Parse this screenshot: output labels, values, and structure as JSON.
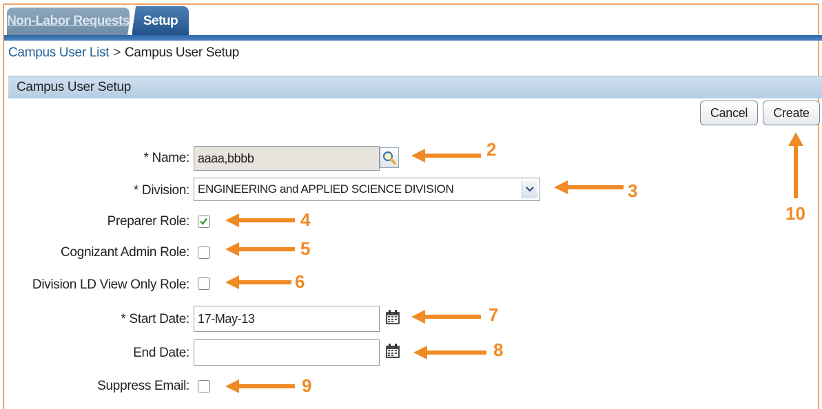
{
  "tabs": [
    {
      "label": "Non-Labor Requests"
    },
    {
      "label": "Setup"
    }
  ],
  "breadcrumb": {
    "link": "Campus User List",
    "separator": ">",
    "current": "Campus User Setup"
  },
  "section": {
    "title": "Campus User Setup"
  },
  "buttons": {
    "cancel": "Cancel",
    "create": "Create"
  },
  "form": {
    "name": {
      "label": "* Name:",
      "value": "aaaa,bbbb"
    },
    "division": {
      "label": "* Division:",
      "value": "ENGINEERING and APPLIED SCIENCE DIVISION"
    },
    "preparer_role": {
      "label": "Preparer Role:",
      "checked": true
    },
    "cognizant_admin_role": {
      "label": "Cognizant Admin Role:",
      "checked": false
    },
    "division_ld_view_only_role": {
      "label": "Division LD View Only Role:",
      "checked": false
    },
    "start_date": {
      "label": "* Start Date:",
      "value": "17-May-13"
    },
    "end_date": {
      "label": "End Date:",
      "value": ""
    },
    "suppress_email": {
      "label": "Suppress Email:",
      "checked": false
    }
  },
  "annotations": {
    "n2": "2",
    "n3": "3",
    "n4": "4",
    "n5": "5",
    "n6": "6",
    "n7": "7",
    "n8": "8",
    "n9": "9",
    "n10": "10",
    "arrow_color": "#f08a24"
  }
}
